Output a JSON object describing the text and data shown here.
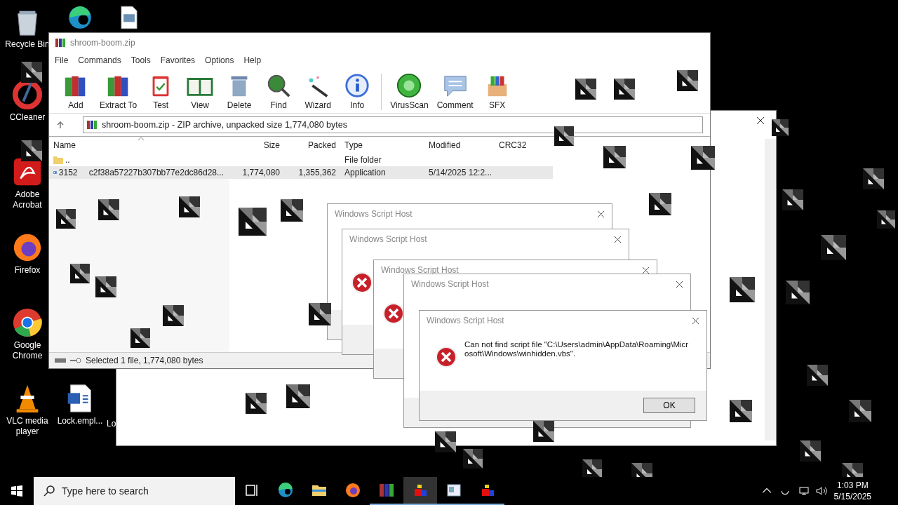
{
  "desktop_icons": [
    {
      "kind": "recycle",
      "label": "Recycle Bin"
    },
    {
      "kind": "edge"
    },
    {
      "kind": "image"
    },
    {
      "kind": "ccleaner",
      "label": "CCleaner"
    },
    {
      "kind": "acrobat",
      "label": "Adobe Acrobat"
    },
    {
      "kind": "firefox",
      "label": "Firefox"
    },
    {
      "kind": "chrome",
      "label": "Google Chrome"
    },
    {
      "kind": "vlc",
      "label": "VLC media player"
    },
    {
      "kind": "word",
      "label": "Lock.empl..."
    },
    {
      "kind": "hidden",
      "label": "Lo"
    }
  ],
  "archiver": {
    "title": "shroom-boom.zip",
    "menu": [
      "File",
      "Commands",
      "Tools",
      "Favorites",
      "Options",
      "Help"
    ],
    "toolbar": [
      {
        "kind": "add",
        "label": "Add"
      },
      {
        "kind": "extract",
        "label": "Extract To"
      },
      {
        "kind": "test",
        "label": "Test"
      },
      {
        "kind": "view",
        "label": "View"
      },
      {
        "kind": "delete",
        "label": "Delete"
      },
      {
        "kind": "find",
        "label": "Find"
      },
      {
        "kind": "wizard",
        "label": "Wizard"
      },
      {
        "kind": "info",
        "label": "Info"
      },
      {
        "kind": "virusscan",
        "label": "VirusScan"
      },
      {
        "kind": "comment",
        "label": "Comment"
      },
      {
        "kind": "sfx",
        "label": "SFX"
      }
    ],
    "address": "shroom-boom.zip - ZIP archive, unpacked size 1,774,080 bytes",
    "columns": [
      "Name",
      "Size",
      "Packed",
      "Type",
      "Modified",
      "CRC32"
    ],
    "rows": [
      {
        "kind": "folder",
        "name_start": "..",
        "type": "File folder",
        "selected": false
      },
      {
        "kind": "app",
        "name_start": "3152",
        "name_end": "c2f38a57227b307bb77e2dc86d28...",
        "size": "1,774,080",
        "packed": "1,355,362",
        "type": "Application",
        "modified": "5/14/2025 12:2...",
        "selected": true
      }
    ],
    "status": "Selected 1 file, 1,774,080 bytes"
  },
  "dialogs": [
    {
      "title": "Windows Script Host",
      "kind": "back"
    },
    {
      "title": "Windows Script Host",
      "kind": "back"
    },
    {
      "title": "Windows Script Host",
      "kind": "back"
    },
    {
      "title": "Windows Script Host",
      "kind": "back"
    },
    {
      "title": "Windows Script Host",
      "kind": "front",
      "message": "Can not find script file \"C:\\Users\\admin\\AppData\\Roaming\\Microsoft\\Windows\\winhidden.vbs\".",
      "button": "OK"
    }
  ],
  "taskbar": {
    "search_placeholder": "Type here to search",
    "apps": [
      {
        "kind": "taskview",
        "running": false,
        "selected": false
      },
      {
        "kind": "edge",
        "running": false,
        "selected": false
      },
      {
        "kind": "explorer",
        "running": false,
        "selected": false
      },
      {
        "kind": "firefox",
        "running": false,
        "selected": false
      },
      {
        "kind": "winrar",
        "running": true,
        "selected": false
      },
      {
        "kind": "cubes",
        "running": true,
        "selected": true
      },
      {
        "kind": "window",
        "running": true,
        "selected": false
      },
      {
        "kind": "cubes",
        "running": true,
        "selected": false
      }
    ],
    "time": "1:03 PM",
    "date": "5/15/2025"
  }
}
